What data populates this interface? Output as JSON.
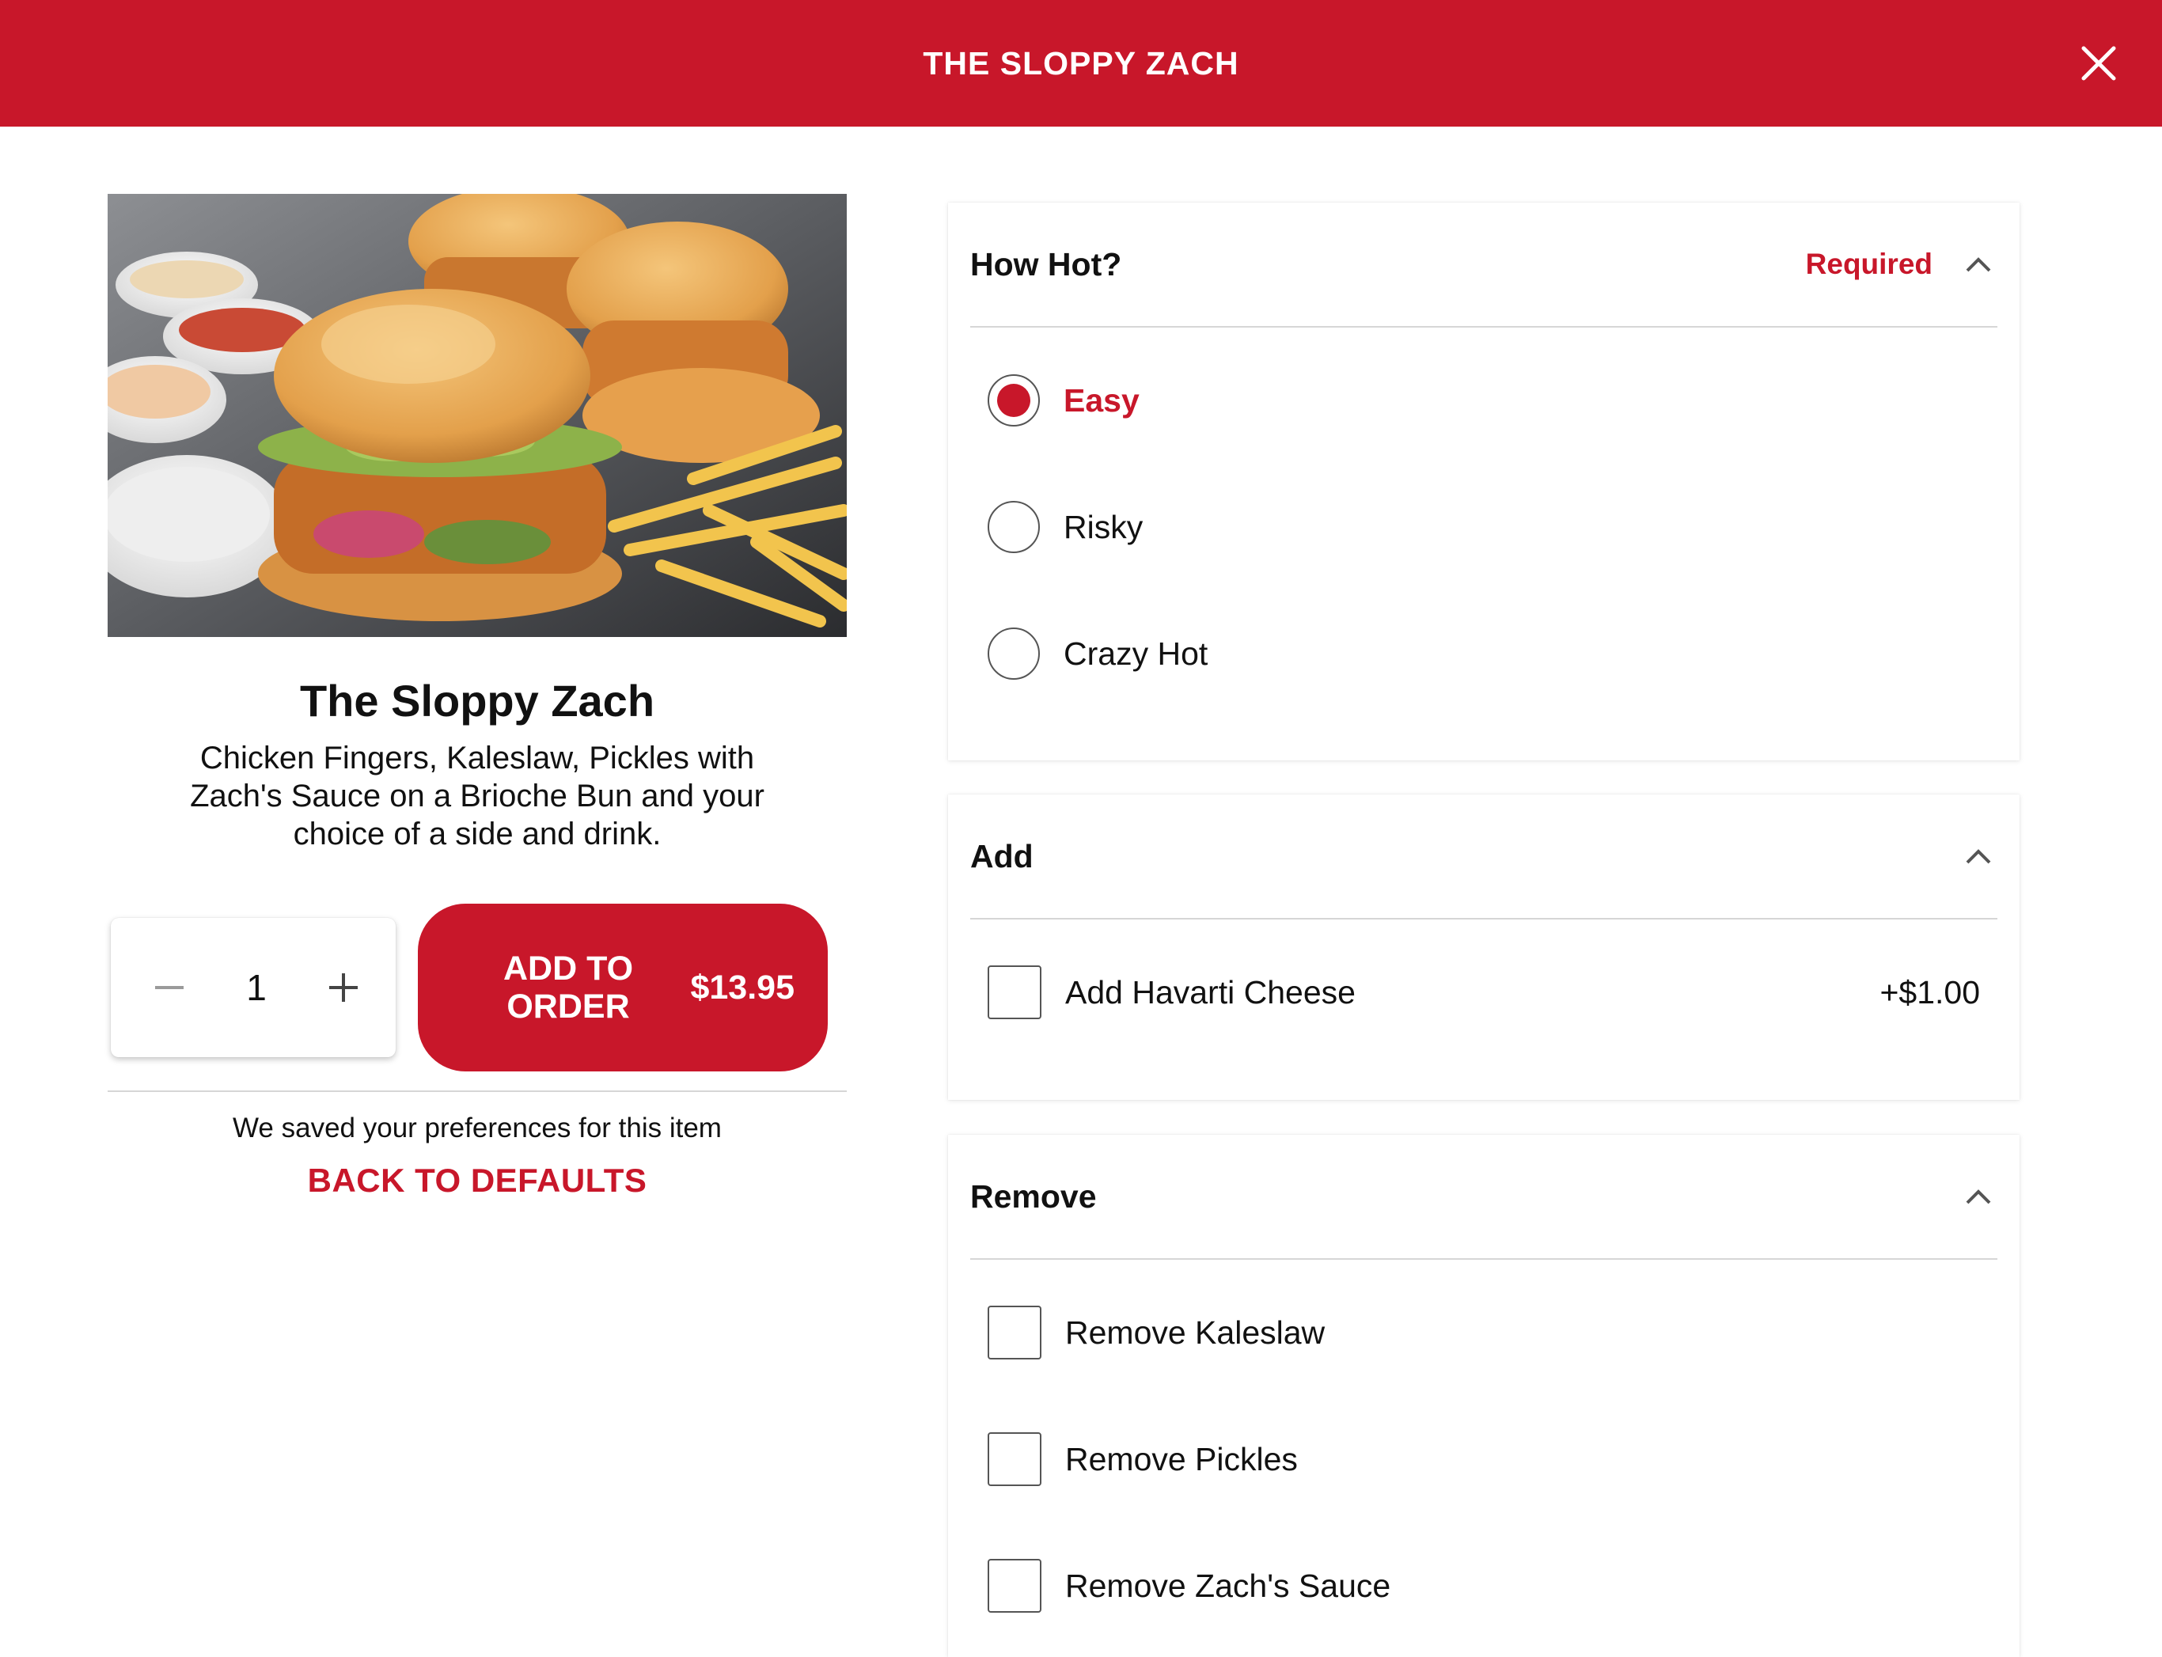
{
  "header": {
    "title": "THE SLOPPY ZACH",
    "close_icon": "close-icon"
  },
  "product": {
    "image_alt": "The Sloppy Zach",
    "name": "The Sloppy Zach",
    "description": "Chicken Fingers, Kaleslaw, Pickles with Zach's Sauce on a Brioche Bun and your choice of a side and drink."
  },
  "order": {
    "quantity": "1",
    "add_label_line1": "ADD TO",
    "add_label_line2": "ORDER",
    "price": "$13.95"
  },
  "preferences": {
    "saved_note": "We saved your preferences for this item",
    "defaults_link": "BACK TO DEFAULTS"
  },
  "sections": {
    "how_hot": {
      "title": "How Hot?",
      "required": "Required",
      "options": [
        {
          "label": "Easy",
          "selected": true
        },
        {
          "label": "Risky",
          "selected": false
        },
        {
          "label": "Crazy Hot",
          "selected": false
        }
      ]
    },
    "add": {
      "title": "Add",
      "options": [
        {
          "label": "Add Havarti Cheese",
          "price": "+$1.00",
          "checked": false
        }
      ]
    },
    "remove": {
      "title": "Remove",
      "options": [
        {
          "label": "Remove Kaleslaw",
          "checked": false
        },
        {
          "label": "Remove Pickles",
          "checked": false
        },
        {
          "label": "Remove Zach's Sauce",
          "checked": false
        }
      ]
    }
  },
  "colors": {
    "brand_red": "#c8172a",
    "text": "#111111",
    "divider": "#d6d6d6"
  }
}
